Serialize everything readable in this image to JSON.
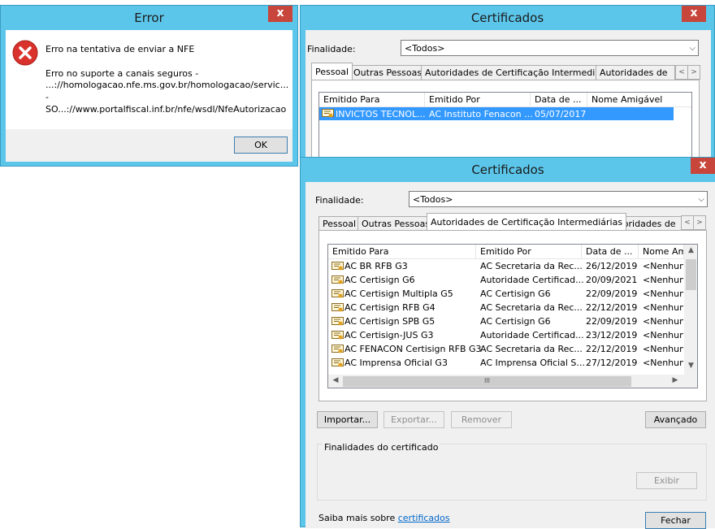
{
  "error_dialog": {
    "title": "Error",
    "close_glyph": "x",
    "line1": "Erro na tentativa de enviar a NFE",
    "line2": "Erro no suporte a canais seguros -",
    "line3": "...://homologacao.nfe.ms.gov.br/homologacao/servic...",
    "line4": "-",
    "line5": "SO...://www.portalfiscal.inf.br/nfe/wsdl/NfeAutorizacao",
    "ok_label": "OK",
    "icon": "error-icon"
  },
  "cert_back": {
    "title": "Certificados",
    "close_glyph": "x",
    "finalidade_label": "Finalidade:",
    "finalidade_value": "<Todos>",
    "tabs": [
      "Pessoal",
      "Outras Pessoas",
      "Autoridades de Certificação Intermediárias",
      "Autoridades de Ce"
    ],
    "columns": [
      "Emitido Para",
      "Emitido Por",
      "Data de ...",
      "Nome Amigável"
    ],
    "rows": [
      {
        "para": "INVICTOS TECNOL...",
        "por": "AC Instituto Fenacon ...",
        "data": "05/07/2017",
        "nome": ""
      }
    ]
  },
  "cert_front": {
    "title": "Certificados",
    "close_glyph": "x",
    "finalidade_label": "Finalidade:",
    "finalidade_value": "<Todos>",
    "tabs": [
      "Pessoal",
      "Outras Pessoas",
      "Autoridades de Certificação Intermediárias",
      "Autoridades de Ce"
    ],
    "columns": [
      "Emitido Para",
      "Emitido Por",
      "Data de ...",
      "Nome Amigá"
    ],
    "rows": [
      {
        "para": "AC BR RFB G3",
        "por": "AC Secretaria da Rec...",
        "data": "26/12/2019",
        "nome": "<Nenhum>"
      },
      {
        "para": "AC Certisign G6",
        "por": "Autoridade Certificad...",
        "data": "20/09/2021",
        "nome": "<Nenhum>"
      },
      {
        "para": "AC Certisign Multipla G5",
        "por": "AC Certisign G6",
        "data": "22/09/2019",
        "nome": "<Nenhum>"
      },
      {
        "para": "AC Certisign RFB G4",
        "por": "AC Secretaria da Rec...",
        "data": "22/12/2019",
        "nome": "<Nenhum>"
      },
      {
        "para": "AC Certisign SPB G5",
        "por": "AC Certisign G6",
        "data": "22/09/2019",
        "nome": "<Nenhum>"
      },
      {
        "para": "AC Certisign-JUS G3",
        "por": "Autoridade Certificad...",
        "data": "23/12/2019",
        "nome": "<Nenhum>"
      },
      {
        "para": "AC FENACON Certisign RFB G3",
        "por": "AC Secretaria da Rec...",
        "data": "22/12/2019",
        "nome": "<Nenhum>"
      },
      {
        "para": "AC Imprensa Oficial G3",
        "por": "AC Imprensa Oficial S...",
        "data": "27/12/2019",
        "nome": "<Nenhum>"
      }
    ],
    "importar": "Importar...",
    "exportar": "Exportar...",
    "remover": "Remover",
    "avancado": "Avançado",
    "finalidades_group": "Finalidades do certificado",
    "exibir": "Exibir",
    "saiba_text": "Saiba mais sobre",
    "saiba_link": "certificados",
    "fechar": "Fechar",
    "hscroll_grip": "III"
  },
  "colors": {
    "title_blue": "#5cc6ea",
    "close_red": "#c7453a",
    "selection": "#3399ff"
  }
}
